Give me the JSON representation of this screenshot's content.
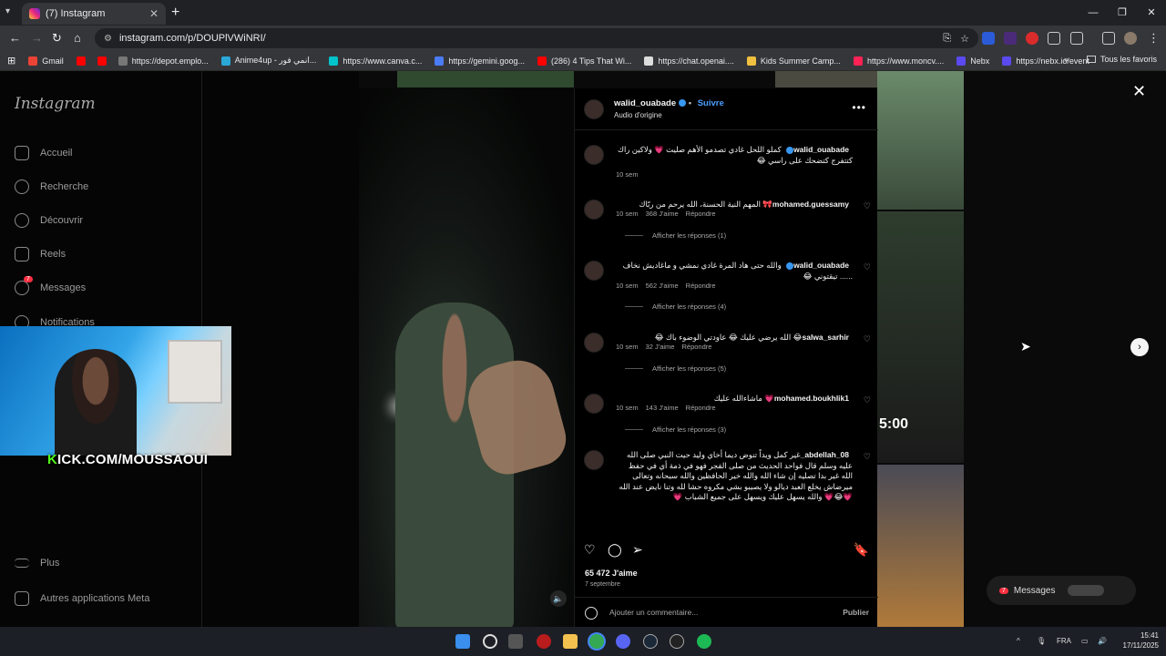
{
  "browser": {
    "tab_title": "(7) Instagram",
    "url": "instagram.com/p/DOUPlVWiNRI/",
    "bookmarks": [
      {
        "label": "Gmail",
        "color": "#ea4335"
      },
      {
        "label": "",
        "color": "#ff0000"
      },
      {
        "label": "",
        "color": "#ff0000"
      },
      {
        "label": "https://depot.emplo...",
        "color": "#777777"
      },
      {
        "label": "Anime4up - انمي فور...",
        "color": "#2aa8d8"
      },
      {
        "label": "https://www.canva.c...",
        "color": "#00c4cc"
      },
      {
        "label": "https://gemini.goog...",
        "color": "#4a7cf7"
      },
      {
        "label": "(286) 4 Tips That Wi...",
        "color": "#ff0000"
      },
      {
        "label": "https://chat.openai....",
        "color": "#dddddd"
      },
      {
        "label": "Kids Summer Camp...",
        "color": "#f0c040"
      },
      {
        "label": "https://www.moncv....",
        "color": "#ff2255"
      },
      {
        "label": "Nebx",
        "color": "#5a4af0"
      },
      {
        "label": "https://nebx.io/event",
        "color": "#5a4af0"
      }
    ],
    "all_favorites": "Tous les favoris"
  },
  "sidebar": {
    "logo": "Instagram",
    "items": [
      {
        "label": "Accueil",
        "icon": "home-icon"
      },
      {
        "label": "Recherche",
        "icon": "search-icon"
      },
      {
        "label": "Découvrir",
        "icon": "compass-icon"
      },
      {
        "label": "Reels",
        "icon": "reels-icon"
      },
      {
        "label": "Messages",
        "icon": "messenger-icon",
        "badge": "7"
      },
      {
        "label": "Notifications",
        "icon": "heart-icon"
      }
    ],
    "more": "Plus",
    "meta": "Autres applications Meta"
  },
  "stream": {
    "overlay_text": "KICK.COM/MOUSSAOUI",
    "overlay_k": "K"
  },
  "post": {
    "author": "walid_ouabade",
    "follow": "Suivre",
    "audio": "Audio d'origine",
    "caption": {
      "user": "walid_ouabade",
      "text": "كملو اللحل غادي تصدمو الأهم صليت 💗 ولاكين راك كتتفرج كتضحك على راسي 😂",
      "time": "10 sem"
    },
    "comments": [
      {
        "user": "mohamed.guessamy",
        "text": "🎀 المهم النية الحسنة، الله يرحم من ربّاك",
        "time": "10 sem",
        "likes": "368 J'aime",
        "reply": "Répondre",
        "replies": "Afficher les réponses (1)"
      },
      {
        "user": "walid_ouabade",
        "text": "والله حتى هاد المرة غادي نمشي و ماغاديش نخاف ...... تيقتوني 😂",
        "time": "10 sem",
        "likes": "562 J'aime",
        "reply": "Répondre",
        "replies": "Afficher les réponses (4)"
      },
      {
        "user": "salwa_sarhir",
        "text": "😂 الله يرضي عليك 😂 عاودتي الوضوء باك 😂",
        "time": "10 sem",
        "likes": "32 J'aime",
        "reply": "Répondre",
        "replies": "Afficher les réponses (5)"
      },
      {
        "user": "mohamed.boukhlik1",
        "text": "💗 ماشاءالله عليك",
        "time": "10 sem",
        "likes": "143 J'aime",
        "reply": "Répondre",
        "replies": "Afficher les réponses (3)"
      },
      {
        "user": "_abdellah_08",
        "text": "غير كمل ويداً تنوض ديما أخاي وليد حيت النبي صلى الله عليه وسلم قال فواحد الحديث من صلى الفجر فهو في ذمة أي في حفظ الله غير بدا تصليه إن شاء الله والله خير الحافظين والله سبحانه وتعالى ميرضاش يخلع العبد ديالو ولا يصيبو بشي مكروه حشا لله وتنا نايض عند الله 💗😂💗 والله يسهل عليك ويسهل على جميع الشباب 💗",
        "time": "",
        "likes": "",
        "reply": "",
        "replies": ""
      }
    ],
    "likes": "65 472 J'aime",
    "date": "7 septembre",
    "add_comment_placeholder": "Ajouter un commentaire...",
    "publish": "Publier"
  },
  "messages_pill": {
    "label": "Messages",
    "badge": "7"
  },
  "taskbar": {
    "lang": "FRA",
    "time": "15:41",
    "date": "17/11/2025"
  },
  "colors": {
    "accent": "#4a9eff",
    "badge": "#ff3040",
    "kick": "#53fc18"
  }
}
